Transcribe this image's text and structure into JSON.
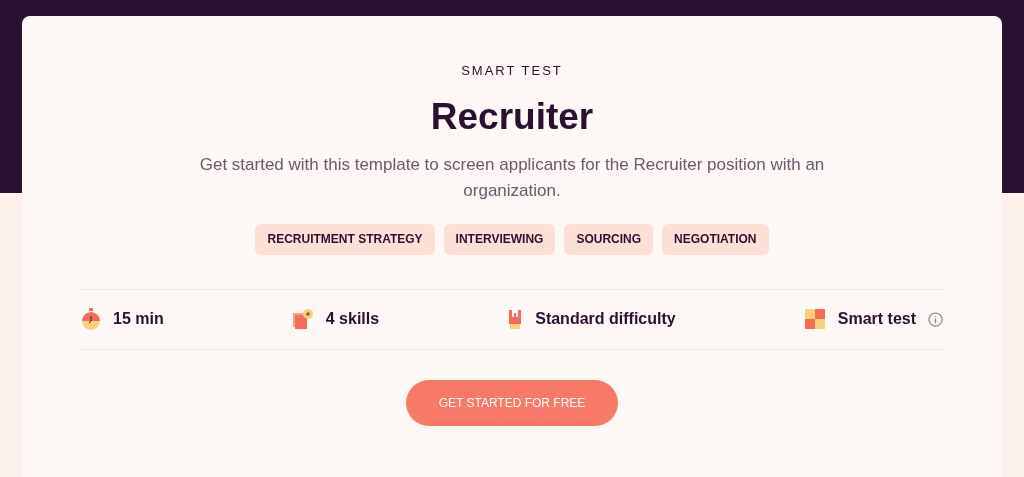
{
  "eyebrow": "SMART TEST",
  "title": "Recruiter",
  "description": "Get started with this template to screen applicants for the Recruiter position with an organization.",
  "tags": [
    "RECRUITMENT STRATEGY",
    "INTERVIEWING",
    "SOURCING",
    "NEGOTIATION"
  ],
  "stats": [
    {
      "kind": "duration",
      "label": "15 min"
    },
    {
      "kind": "skills",
      "label": "4 skills"
    },
    {
      "kind": "difficulty",
      "label": "Standard difficulty"
    },
    {
      "kind": "type",
      "label": "Smart test",
      "info": true
    }
  ],
  "cta": "GET STARTED FOR FREE"
}
